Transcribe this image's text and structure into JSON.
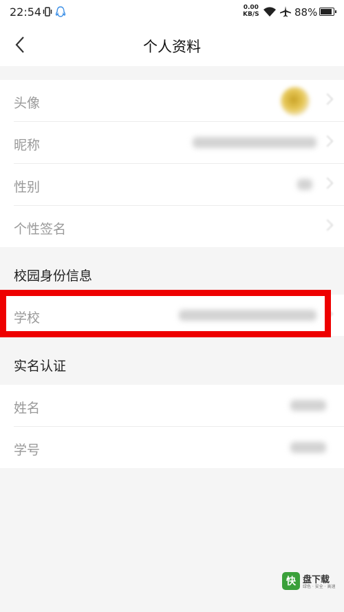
{
  "status_bar": {
    "time": "22:54",
    "net_speed": "0.00",
    "net_unit": "KB/S",
    "battery": "88%"
  },
  "nav": {
    "title": "个人资料"
  },
  "profile": {
    "avatar_label": "头像",
    "nickname_label": "昵称",
    "gender_label": "性别",
    "signature_label": "个性签名"
  },
  "campus": {
    "header": "校园身份信息",
    "school_label": "学校"
  },
  "realname": {
    "header": "实名认证",
    "name_label": "姓名",
    "student_id_label": "学号"
  },
  "watermark": {
    "icon": "快",
    "text": "盘下载",
    "sub": "绿色 · 安全 · 高速"
  },
  "icons": {
    "back": "back-arrow-icon",
    "wifi": "wifi-icon",
    "airplane": "airplane-icon",
    "battery": "battery-icon",
    "vibrate": "vibrate-icon",
    "qq": "qq-icon"
  },
  "colors": {
    "highlight": "#ee0000"
  }
}
